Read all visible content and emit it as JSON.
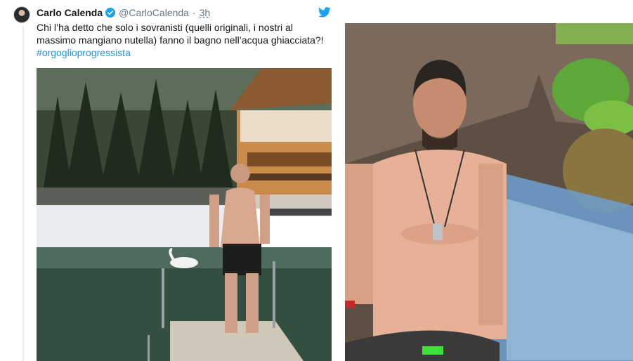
{
  "tweet": {
    "author_name": "Carlo Calenda",
    "handle": "@CarloCalenda",
    "separator": "·",
    "time": "3h",
    "text": "Chi l’ha detto che solo i sovranisti (quelli originali, i nostri al massimo mangiano nutella) fanno il bagno nell’acqua ghiacciata?!",
    "hashtag": "#orgoglioprogressista"
  },
  "icons": {
    "avatar": "user-avatar",
    "verified": "verified-badge-icon",
    "brand": "twitter-bird-icon"
  },
  "colors": {
    "link": "#1b95e0",
    "muted": "#657786",
    "verified": "#1da1f2"
  }
}
